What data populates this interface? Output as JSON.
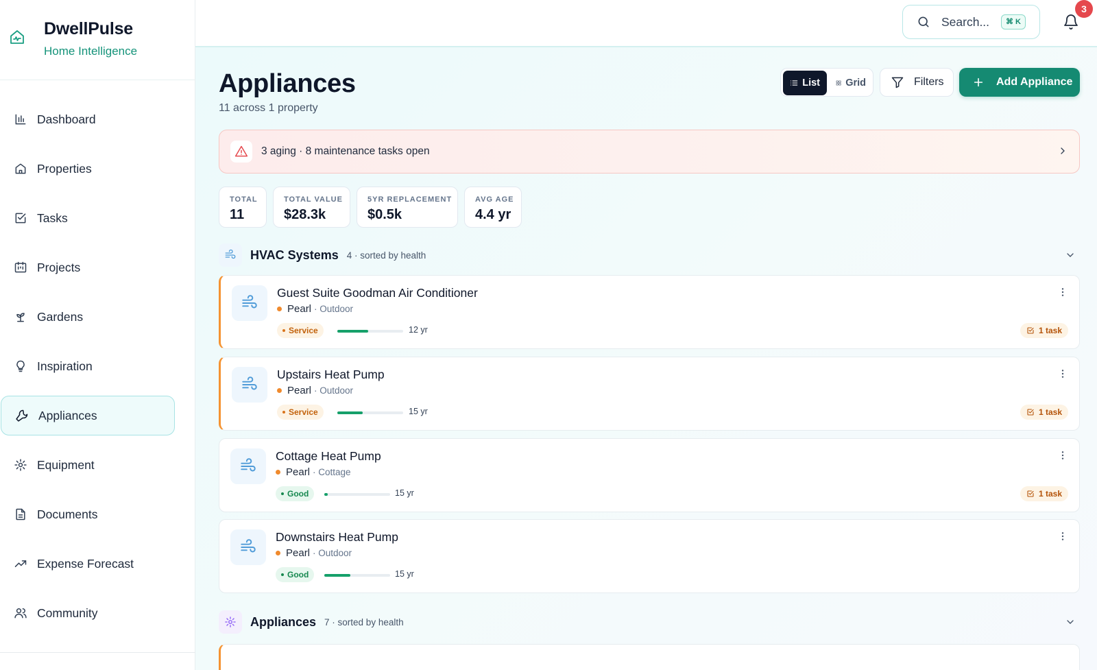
{
  "brand": {
    "name": "DwellPulse",
    "tagline": "Home Intelligence"
  },
  "nav": [
    {
      "label": "Dashboard",
      "icon": "bar-chart-icon"
    },
    {
      "label": "Properties",
      "icon": "home-icon"
    },
    {
      "label": "Tasks",
      "icon": "check-square-icon"
    },
    {
      "label": "Projects",
      "icon": "calendar-icon"
    },
    {
      "label": "Gardens",
      "icon": "sprout-icon"
    },
    {
      "label": "Inspiration",
      "icon": "lightbulb-icon"
    },
    {
      "label": "Appliances",
      "icon": "wrench-icon",
      "active": true
    },
    {
      "label": "Equipment",
      "icon": "gear-icon"
    },
    {
      "label": "Documents",
      "icon": "document-icon"
    },
    {
      "label": "Expense Forecast",
      "icon": "trending-up-icon"
    },
    {
      "label": "Community",
      "icon": "users-icon"
    }
  ],
  "topbar": {
    "search_placeholder": "Search...",
    "shortcut": "⌘ K",
    "notification_count": "3"
  },
  "page": {
    "title": "Appliances",
    "subtitle": "11 across 1 property",
    "view_list": "List",
    "view_grid": "Grid",
    "filters": "Filters",
    "add": "Add Appliance"
  },
  "alert": {
    "text": "3 aging · 8 maintenance tasks open"
  },
  "stats": [
    {
      "label": "TOTAL",
      "value": "11"
    },
    {
      "label": "TOTAL VALUE",
      "value": "$28.3k"
    },
    {
      "label": "5YR REPLACEMENT",
      "value": "$0.5k"
    },
    {
      "label": "AVG AGE",
      "value": "4.4 yr"
    }
  ],
  "groups": [
    {
      "title": "HVAC Systems",
      "meta": "4 · sorted by health",
      "icon": "wind-icon",
      "items": [
        {
          "name": "Guest Suite Goodman Air Conditioner",
          "property": "Pearl",
          "location": "· Outdoor",
          "status": "Service",
          "health": 0.47,
          "age": "12 yr",
          "task": "1 task"
        },
        {
          "name": "Upstairs Heat Pump",
          "property": "Pearl",
          "location": "· Outdoor",
          "status": "Service",
          "health": 0.39,
          "age": "15 yr",
          "task": "1 task"
        },
        {
          "name": "Cottage Heat Pump",
          "property": "Pearl",
          "location": "· Cottage",
          "status": "Good",
          "health": 0.05,
          "age": "15 yr",
          "task": "1 task"
        },
        {
          "name": "Downstairs Heat Pump",
          "property": "Pearl",
          "location": "· Outdoor",
          "status": "Good",
          "health": 0.4,
          "age": "15 yr",
          "task": ""
        }
      ]
    },
    {
      "title": "Appliances",
      "meta": "7 · sorted by health",
      "icon": "gear-icon"
    }
  ],
  "colors": {
    "accent": "#158a72",
    "service": "#c2620c",
    "good": "#16884f",
    "alert": "#e5484d"
  }
}
